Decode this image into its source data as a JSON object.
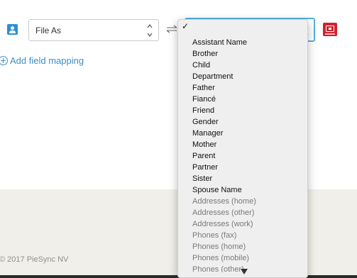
{
  "mapping_row": {
    "source_field_value": "File As",
    "swap_icon": "swap-arrows-icon",
    "contact_icon": "contact-card-icon",
    "delete_icon": "delete-icon"
  },
  "add_field_mapping": {
    "label": "Add field mapping"
  },
  "dropdown": {
    "checkmark": "✓",
    "items": [
      {
        "label": "Assistant Name",
        "enabled": true
      },
      {
        "label": "Brother",
        "enabled": true
      },
      {
        "label": "Child",
        "enabled": true
      },
      {
        "label": "Department",
        "enabled": true
      },
      {
        "label": "Father",
        "enabled": true
      },
      {
        "label": "Fiancé",
        "enabled": true
      },
      {
        "label": "Friend",
        "enabled": true
      },
      {
        "label": "Gender",
        "enabled": true
      },
      {
        "label": "Manager",
        "enabled": true
      },
      {
        "label": "Mother",
        "enabled": true
      },
      {
        "label": "Parent",
        "enabled": true
      },
      {
        "label": "Partner",
        "enabled": true
      },
      {
        "label": "Sister",
        "enabled": true
      },
      {
        "label": "Spouse Name",
        "enabled": true
      },
      {
        "label": "Addresses (home)",
        "enabled": false
      },
      {
        "label": "Addresses (other)",
        "enabled": false
      },
      {
        "label": "Addresses (work)",
        "enabled": false
      },
      {
        "label": "Phones (fax)",
        "enabled": false
      },
      {
        "label": "Phones (home)",
        "enabled": false
      },
      {
        "label": "Phones (mobile)",
        "enabled": false
      },
      {
        "label": "Phones (other)",
        "enabled": false
      }
    ]
  },
  "footer": {
    "copyright": "© 2017 PieSync NV"
  },
  "colors": {
    "accent": "#3b8fc4",
    "focus_border": "#52b2dc",
    "delete": "#d0222d",
    "footer_bg": "#f0efea"
  }
}
